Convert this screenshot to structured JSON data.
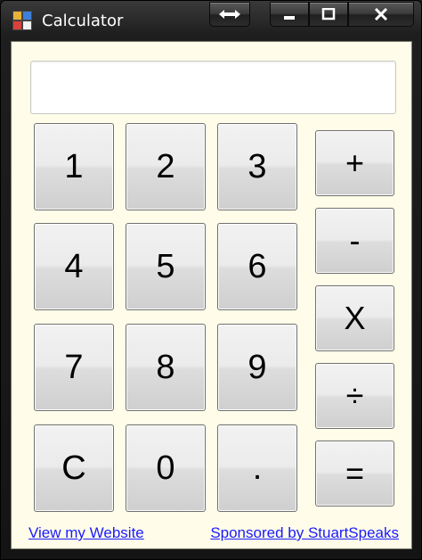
{
  "window": {
    "title": "Calculator",
    "icon": "calculator-app-icon",
    "controls": [
      "resize-icon",
      "minimize-icon",
      "maximize-icon",
      "close-icon"
    ]
  },
  "display": {
    "value": ""
  },
  "keypad": {
    "digits": [
      "1",
      "2",
      "3",
      "4",
      "5",
      "6",
      "7",
      "8",
      "9",
      "C",
      "0",
      "."
    ],
    "operators": [
      "+",
      "-",
      "X",
      "÷",
      "="
    ]
  },
  "footer": {
    "left_link": "View my Website",
    "right_link": "Sponsored by StuartSpeaks"
  },
  "colors": {
    "client_background": "#fffde9",
    "link": "#1a1aff",
    "chrome": "#1e1e1e"
  }
}
